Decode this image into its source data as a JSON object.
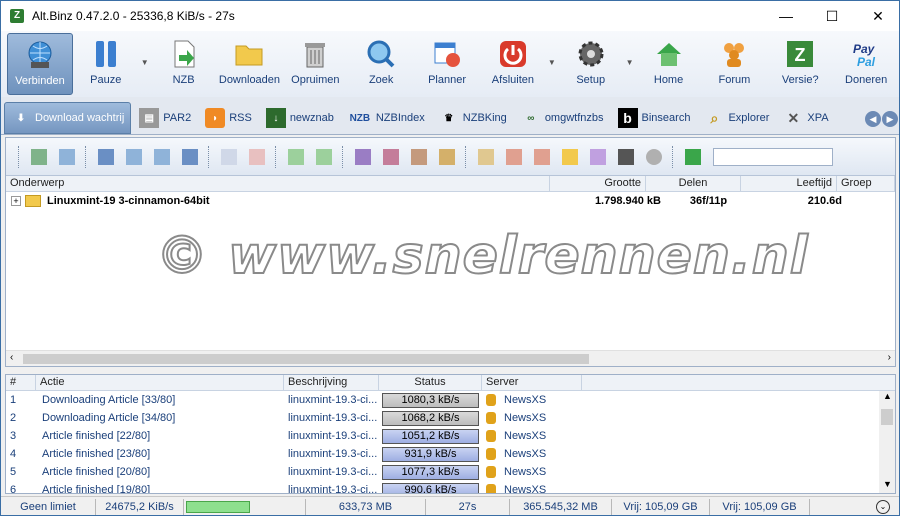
{
  "window": {
    "title": "Alt.Binz 0.47.2.0 - 25336,8 KiB/s - 27s",
    "app_icon": "Z",
    "minimize": "—",
    "maximize": "☐",
    "close": "✕"
  },
  "toolbar": [
    {
      "label": "Verbinden",
      "icon": "globe-connect-icon",
      "active": true
    },
    {
      "label": "Pauze",
      "icon": "pause-icon",
      "dropdown": true
    },
    {
      "label": "NZB",
      "icon": "nzb-file-icon"
    },
    {
      "label": "Downloaden",
      "icon": "folder-icon"
    },
    {
      "label": "Opruimen",
      "icon": "trash-icon"
    },
    {
      "label": "Zoek",
      "icon": "magnifier-icon"
    },
    {
      "label": "Planner",
      "icon": "calendar-clock-icon"
    },
    {
      "label": "Afsluiten",
      "icon": "power-icon",
      "dropdown": true
    },
    {
      "label": "Setup",
      "icon": "gear-icon",
      "dropdown": true
    },
    {
      "label": "Home",
      "icon": "house-icon"
    },
    {
      "label": "Forum",
      "icon": "people-icon"
    },
    {
      "label": "Versie?",
      "icon": "version-icon"
    },
    {
      "label": "Doneren",
      "icon": "paypal-icon"
    }
  ],
  "tabs": [
    {
      "label": "Download wachtrij",
      "active": true,
      "icon": "download-queue-icon"
    },
    {
      "label": "PAR2",
      "icon": "par2-icon"
    },
    {
      "label": "RSS",
      "icon": "rss-icon"
    },
    {
      "label": "newznab",
      "icon": "newznab-icon"
    },
    {
      "label": "NZBIndex",
      "icon": "nzbindex-icon"
    },
    {
      "label": "NZBKing",
      "icon": "nzbking-icon"
    },
    {
      "label": "omgwtfnzbs",
      "icon": "omgwtfnzbs-icon"
    },
    {
      "label": "Binsearch",
      "icon": "binsearch-icon"
    },
    {
      "label": "Explorer",
      "icon": "explorer-icon"
    },
    {
      "label": "XPA",
      "icon": "xpa-icon"
    }
  ],
  "queue": {
    "columns": [
      "Onderwerp",
      "Grootte",
      "Delen",
      "Leeftijd",
      "Groep"
    ],
    "rows": [
      {
        "subject": "Linuxmint-19 3-cinnamon-64bit",
        "size": "1.798.940 kB",
        "parts": "36f/11p",
        "age": "210.6d",
        "group": ""
      }
    ]
  },
  "log": {
    "columns": [
      "#",
      "Actie",
      "Beschrijving",
      "Status",
      "Server"
    ],
    "rows": [
      {
        "num": "1",
        "action": "Downloading Article [33/80]",
        "desc": "linuxmint-19.3-ci...",
        "status": "1080,3 kB/s",
        "status_style": "gray",
        "server": "NewsXS"
      },
      {
        "num": "2",
        "action": "Downloading Article [34/80]",
        "desc": "linuxmint-19.3-ci...",
        "status": "1068,2 kB/s",
        "status_style": "gray",
        "server": "NewsXS"
      },
      {
        "num": "3",
        "action": "Article finished [22/80]",
        "desc": "linuxmint-19.3-ci...",
        "status": "1051,2 kB/s",
        "status_style": "blue",
        "server": "NewsXS"
      },
      {
        "num": "4",
        "action": "Article finished [23/80]",
        "desc": "linuxmint-19.3-ci...",
        "status": "931,9 kB/s",
        "status_style": "blue",
        "server": "NewsXS"
      },
      {
        "num": "5",
        "action": "Article finished [20/80]",
        "desc": "linuxmint-19.3-ci...",
        "status": "1077,3 kB/s",
        "status_style": "blue",
        "server": "NewsXS"
      },
      {
        "num": "6",
        "action": "Article finished [19/80]",
        "desc": "linuxmint-19.3-ci...",
        "status": "990,6 kB/s",
        "status_style": "blue",
        "server": "NewsXS"
      }
    ]
  },
  "status": {
    "limit": "Geen limiet",
    "speed": "24675,2 KiB/s",
    "progress": 0.55,
    "size": "633,73 MB",
    "time": "27s",
    "total": "365.545,32 MB",
    "free1": "Vrij: 105,09 GB",
    "free2": "Vrij: 105,09 GB"
  },
  "watermark": "© www.snelrennen.nl"
}
